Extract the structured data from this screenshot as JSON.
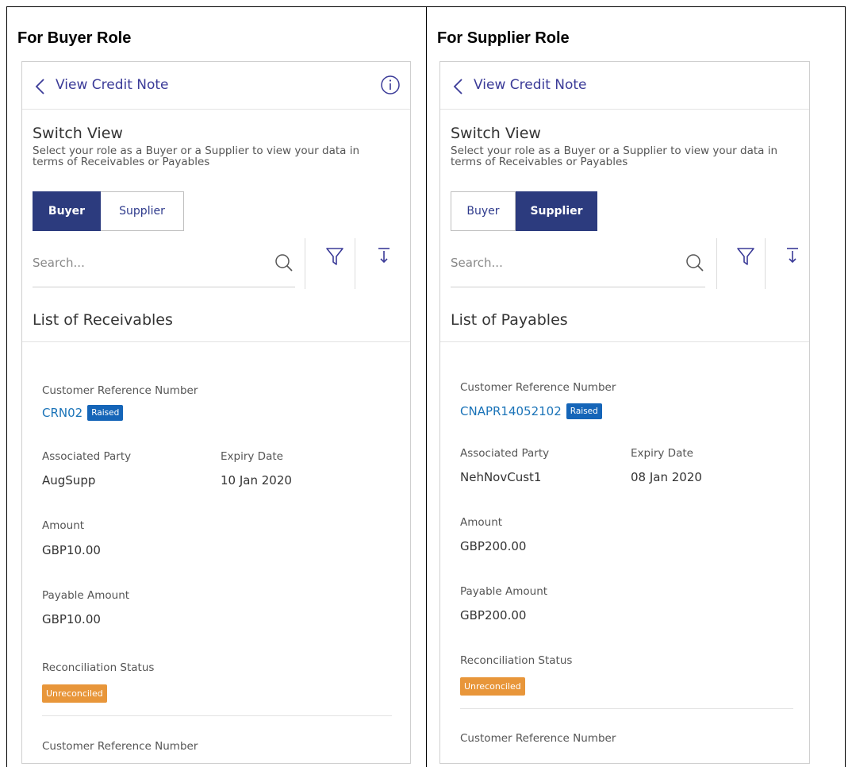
{
  "columns": [
    {
      "heading": "For Buyer Role",
      "screen": {
        "header_title": "View Credit Note",
        "switch_title": "Switch View",
        "switch_desc": "Select your role as a Buyer or a Supplier to view your data in terms of Receivables or Payables",
        "buyer_label": "Buyer",
        "supplier_label": "Supplier",
        "active_role": "Buyer",
        "search_placeholder": "Search...",
        "list_title": "List of Receivables",
        "card": {
          "ref_label": "Customer Reference Number",
          "ref_value": "CRN02",
          "ref_status": "Raised",
          "party_label": "Associated Party",
          "party_value": "AugSupp",
          "expiry_label": "Expiry Date",
          "expiry_value": "10 Jan 2020",
          "amount_label": "Amount",
          "amount_value": "GBP10.00",
          "payable_label": "Payable Amount",
          "payable_value": "GBP10.00",
          "recon_label": "Reconciliation Status",
          "recon_value": "Unreconciled"
        },
        "next_ref_label": "Customer Reference Number"
      }
    },
    {
      "heading": "For Supplier Role",
      "screen": {
        "header_title": "View Credit Note",
        "switch_title": "Switch View",
        "switch_desc": "Select your role as a Buyer or a Supplier to view your data in terms of Receivables or Payables",
        "buyer_label": "Buyer",
        "supplier_label": "Supplier",
        "active_role": "Supplier",
        "search_placeholder": "Search...",
        "list_title": "List of Payables",
        "card": {
          "ref_label": "Customer Reference Number",
          "ref_value": "CNAPR14052102",
          "ref_status": "Raised",
          "party_label": "Associated Party",
          "party_value": "NehNovCust1",
          "expiry_label": "Expiry Date",
          "expiry_value": "08 Jan 2020",
          "amount_label": "Amount",
          "amount_value": "GBP200.00",
          "payable_label": "Payable Amount",
          "payable_value": "GBP200.00",
          "recon_label": "Reconciliation Status",
          "recon_value": "Unreconciled"
        },
        "next_ref_label": "Customer Reference Number"
      }
    }
  ],
  "colors": {
    "accent": "#3b3b98",
    "active_segment": "#2c3b7e",
    "link": "#1a73b8",
    "raised_badge": "#1565b8",
    "unreconciled_badge": "#e8963a"
  },
  "icons": [
    "chevron-left-icon",
    "info-icon",
    "search-icon",
    "filter-icon",
    "sort-icon"
  ]
}
